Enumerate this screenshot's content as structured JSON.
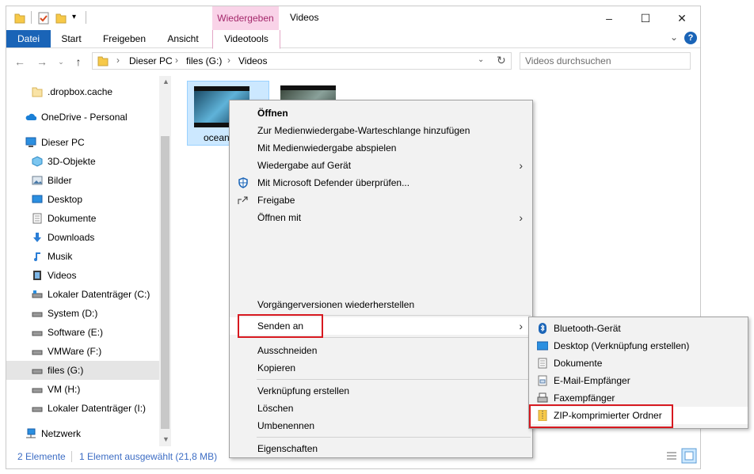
{
  "window": {
    "title": "Videos",
    "contextual_tab_group": "Wiedergeben",
    "caption": {
      "minimize": "–",
      "maximize": "☐",
      "close": "✕"
    }
  },
  "ribbon": {
    "tabs": [
      "Datei",
      "Start",
      "Freigeben",
      "Ansicht",
      "Videotools"
    ],
    "collapse": "⌄",
    "help": "?"
  },
  "address": {
    "path": [
      "Dieser PC",
      "files (G:)",
      "Videos"
    ],
    "separator": "›",
    "search_placeholder": "Videos durchsuchen"
  },
  "nav": {
    "items": [
      {
        "label": ".dropbox.cache",
        "icon": "folder-icon"
      },
      {
        "label": "OneDrive - Personal",
        "icon": "cloud-icon"
      },
      {
        "label": "Dieser PC",
        "icon": "computer-icon"
      },
      {
        "label": "3D-Objekte",
        "icon": "cube-icon"
      },
      {
        "label": "Bilder",
        "icon": "pictures-icon"
      },
      {
        "label": "Desktop",
        "icon": "desktop-icon"
      },
      {
        "label": "Dokumente",
        "icon": "document-icon"
      },
      {
        "label": "Downloads",
        "icon": "download-arrow-icon"
      },
      {
        "label": "Musik",
        "icon": "music-note-icon"
      },
      {
        "label": "Videos",
        "icon": "video-icon"
      },
      {
        "label": "Lokaler Datenträger (C:)",
        "icon": "drive-icon"
      },
      {
        "label": "System (D:)",
        "icon": "drive-icon"
      },
      {
        "label": "Software (E:)",
        "icon": "drive-icon"
      },
      {
        "label": "VMWare (F:)",
        "icon": "drive-icon"
      },
      {
        "label": "files (G:)",
        "icon": "drive-icon"
      },
      {
        "label": "VM (H:)",
        "icon": "drive-icon"
      },
      {
        "label": "Lokaler Datenträger (I:)",
        "icon": "drive-icon"
      },
      {
        "label": "Netzwerk",
        "icon": "network-icon"
      }
    ],
    "selected": "files (G:)"
  },
  "content": {
    "files": [
      {
        "label": "ocean",
        "selected": true
      },
      {
        "label": "",
        "selected": false
      }
    ]
  },
  "status": {
    "count": "2 Elemente",
    "selection": "1 Element ausgewählt (21,8 MB)"
  },
  "context_menu": {
    "items": [
      {
        "label": "Öffnen",
        "bold": true
      },
      {
        "label": "Zur Medienwiedergabe-Warteschlange hinzufügen"
      },
      {
        "label": "Mit Medienwiedergabe abspielen"
      },
      {
        "label": "Wiedergabe auf Gerät",
        "submenu": true
      },
      {
        "label": "Mit Microsoft Defender überprüfen...",
        "icon": "defender-shield-icon"
      },
      {
        "label": "Freigabe",
        "icon": "share-icon"
      },
      {
        "label": "Öffnen mit",
        "submenu": true
      },
      {
        "label": "Vorgängerversionen wiederherstellen"
      },
      {
        "label": "Senden an",
        "submenu": true,
        "highlighted": true
      },
      {
        "label": "Ausschneiden"
      },
      {
        "label": "Kopieren"
      },
      {
        "label": "Verknüpfung erstellen"
      },
      {
        "label": "Löschen"
      },
      {
        "label": "Umbenennen"
      },
      {
        "label": "Eigenschaften"
      }
    ],
    "submenu_arrow": "›"
  },
  "send_to_menu": {
    "items": [
      {
        "label": "Bluetooth-Gerät",
        "icon": "bluetooth-icon"
      },
      {
        "label": "Desktop (Verknüpfung erstellen)",
        "icon": "desktop-icon"
      },
      {
        "label": "Dokumente",
        "icon": "document-icon"
      },
      {
        "label": "E-Mail-Empfänger",
        "icon": "mail-icon"
      },
      {
        "label": "Faxempfänger",
        "icon": "fax-icon"
      },
      {
        "label": "ZIP-komprimierter Ordner",
        "icon": "zip-folder-icon",
        "highlighted": true
      }
    ]
  },
  "colors": {
    "accent": "#1a64b7",
    "context_tab": "#f9d3e8",
    "highlight_border": "#d71920"
  }
}
